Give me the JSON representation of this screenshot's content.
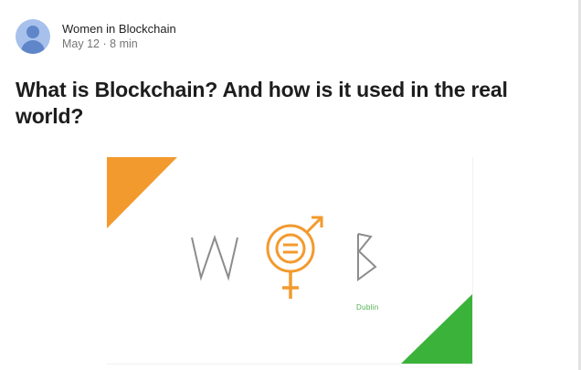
{
  "author": {
    "name": "Women in Blockchain",
    "avatar_icon": "user-avatar-icon",
    "date": "May 12",
    "separator": "·",
    "read_time": "8 min"
  },
  "post": {
    "title": "What is Blockchain? And how is it used in the real world?"
  },
  "hero_image": {
    "logo_left_letter": "W",
    "logo_right_letter": "B",
    "logo_center_icon": "gender-symbol-icon",
    "sublabel": "Dublin",
    "colors": {
      "orange": "#f39a2e",
      "green": "#3bb33b",
      "gray_letters": "#8c8c8c",
      "avatar_bg": "#a7c1ec",
      "avatar_fg": "#5f86c8"
    }
  }
}
